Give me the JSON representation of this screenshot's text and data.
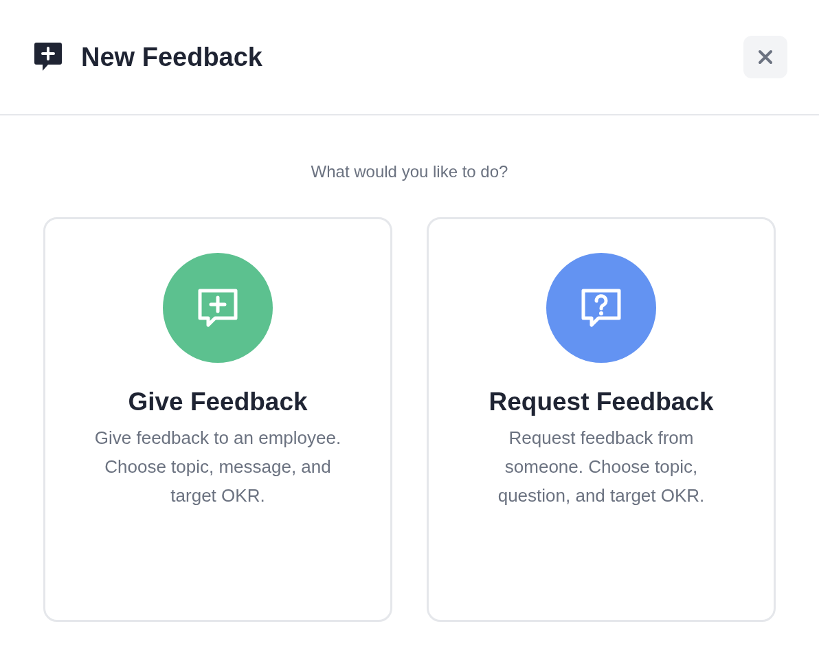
{
  "dialog": {
    "title": "New Feedback",
    "prompt": "What would you like to do?"
  },
  "options": [
    {
      "kind": "give",
      "color": "#5cc18f",
      "title": "Give Feedback",
      "description": "Give feedback to an employee. Choose topic, message, and target OKR."
    },
    {
      "kind": "request",
      "color": "#6393f2",
      "title": "Request Feedback",
      "description": "Request feedback from someone. Choose topic, question, and target OKR."
    }
  ]
}
